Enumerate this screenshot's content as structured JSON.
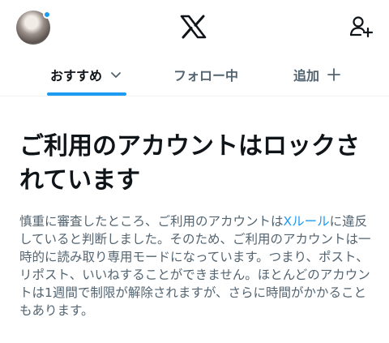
{
  "header": {
    "logo_icon": "x-logo-icon",
    "add_account_icon": "add-user-icon",
    "notification_dot_color": "#1d9bf0"
  },
  "tabs": [
    {
      "label": "おすすめ",
      "icon": "chevron-down-icon",
      "active": true
    },
    {
      "label": "フォロー中",
      "active": false
    },
    {
      "label": "追加",
      "icon": "plus-icon",
      "active": false
    }
  ],
  "accent_color": "#1d9bf0",
  "notice": {
    "title": "ご利用のアカウントはロックされています",
    "text_before_link": "慎重に審査したところ、ご利用のアカウントは",
    "link_text": "Xルール",
    "text_after_link": "に違反していると判断しました。そのため、ご利用のアカウントは一時的に読み取り専用モードになっています。つまり、ポスト、リポスト、いいねすることができません。ほとんどのアカウントは1週間で制限が解除されますが、さらに時間がかかることもあります。"
  }
}
